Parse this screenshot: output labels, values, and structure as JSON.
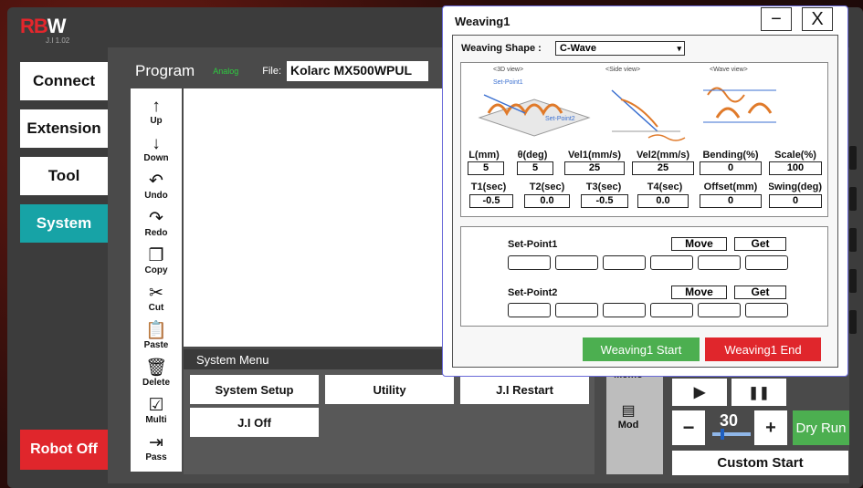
{
  "brand": {
    "logo_rb": "RB",
    "logo_w": "W",
    "version": "J.I 1.02"
  },
  "nav": {
    "connect": "Connect",
    "extension": "Extension",
    "tool": "Tool",
    "system": "System",
    "robot_off": "Robot Off"
  },
  "program": {
    "title": "Program",
    "mode": "Analog",
    "file_label": "File:",
    "file_name": "Kolarc MX500WPUL"
  },
  "tools": [
    {
      "icon": "↑",
      "label": "Up"
    },
    {
      "icon": "↓",
      "label": "Down"
    },
    {
      "icon": "↶",
      "label": "Undo"
    },
    {
      "icon": "↷",
      "label": "Redo"
    },
    {
      "icon": "❐",
      "label": "Copy"
    },
    {
      "icon": "✂",
      "label": "Cut"
    },
    {
      "icon": "📋",
      "label": "Paste"
    },
    {
      "icon": "🗑",
      "label": "Delete"
    },
    {
      "icon": "☑",
      "label": "Multi"
    },
    {
      "icon": "⇥",
      "label": "Pass"
    }
  ],
  "system_menu": {
    "title": "System Menu",
    "system_setup": "System Setup",
    "utility": "Utility",
    "ji_restart": "J.I Restart",
    "ji_off": "J.I Off"
  },
  "right_panel": {
    "memo": "Memo",
    "mod": "Mod"
  },
  "controls": {
    "play": "▶",
    "pause": "❚❚",
    "minus": "−",
    "plus": "+",
    "speed": "30",
    "dry_run": "Dry Run",
    "custom_start": "Custom Start"
  },
  "dialog": {
    "title": "Weaving1",
    "minimize": "−",
    "close": "X",
    "shape_label": "Weaving Shape :",
    "shape_value": "C-Wave",
    "views": {
      "v3d": "<3D view>",
      "side": "<Side view>",
      "wave": "<Wave view>",
      "sp1": "Set-Point1",
      "sp2": "Set-Point2"
    },
    "params_row1": [
      {
        "label": "L(mm)",
        "value": "5"
      },
      {
        "label": "θ(deg)",
        "value": "5"
      },
      {
        "label": "Vel1(mm/s)",
        "value": "25"
      },
      {
        "label": "Vel2(mm/s)",
        "value": "25"
      },
      {
        "label": "Bending(%)",
        "value": "0"
      },
      {
        "label": "Scale(%)",
        "value": "100"
      }
    ],
    "params_row2": [
      {
        "label": "T1(sec)",
        "value": "-0.5"
      },
      {
        "label": "T2(sec)",
        "value": "0.0"
      },
      {
        "label": "T3(sec)",
        "value": "-0.5"
      },
      {
        "label": "T4(sec)",
        "value": "0.0"
      },
      {
        "label": "Offset(mm)",
        "value": "0"
      },
      {
        "label": "Swing(deg)",
        "value": "0"
      }
    ],
    "setpoint1": {
      "label": "Set-Point1",
      "move": "Move",
      "get": "Get"
    },
    "setpoint2": {
      "label": "Set-Point2",
      "move": "Move",
      "get": "Get"
    },
    "start": "Weaving1 Start",
    "end": "Weaving1 End"
  },
  "colors": {
    "accent_teal": "#17a3a6",
    "brand_red": "#e0262c",
    "green": "#4caf50"
  }
}
